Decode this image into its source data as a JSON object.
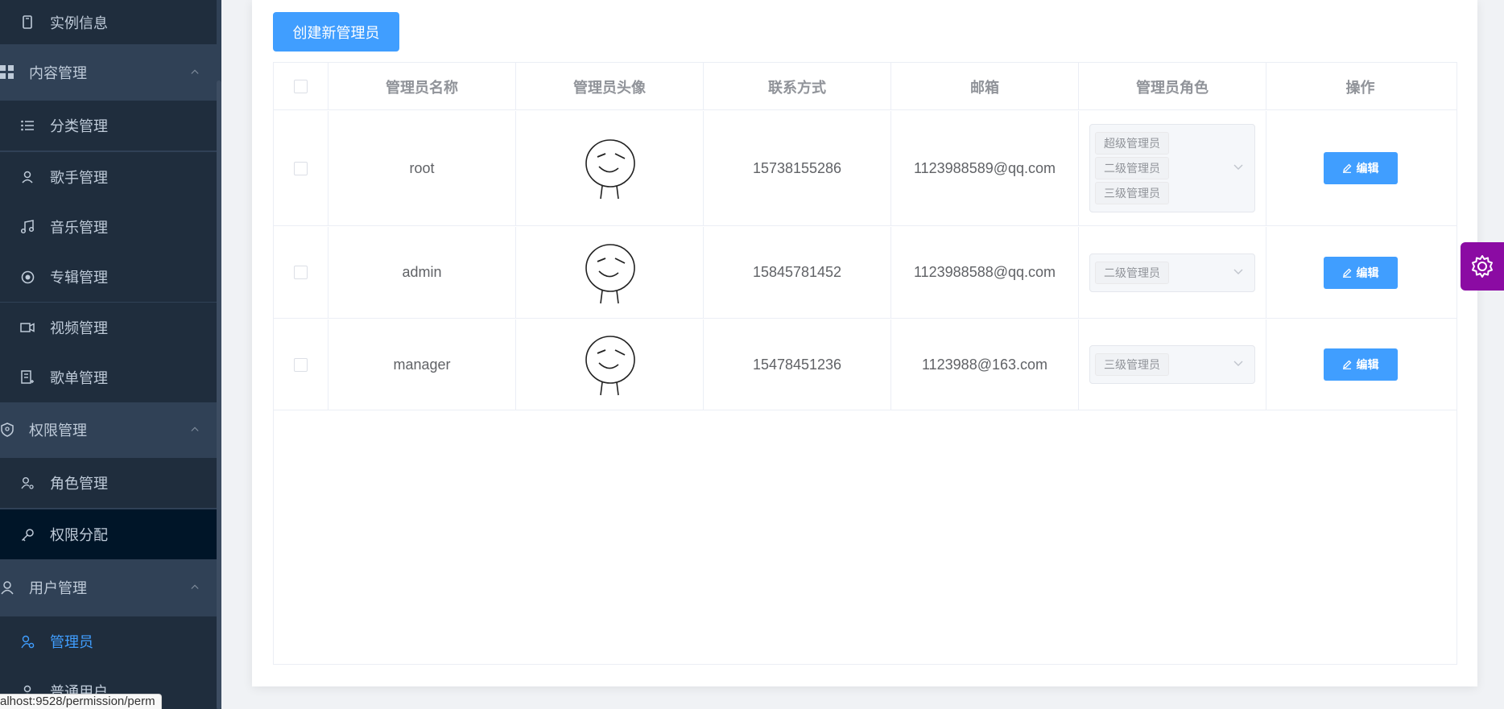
{
  "sidebar": {
    "items": [
      {
        "label": "实例信息",
        "icon": "phone-icon"
      },
      {
        "label": "内容管理",
        "icon": "grid-icon"
      },
      {
        "label": "分类管理",
        "icon": "list-icon"
      },
      {
        "label": "歌手管理",
        "icon": "user-icon"
      },
      {
        "label": "音乐管理",
        "icon": "music-icon"
      },
      {
        "label": "专辑管理",
        "icon": "disc-icon"
      },
      {
        "label": "视频管理",
        "icon": "video-icon"
      },
      {
        "label": "歌单管理",
        "icon": "playlist-icon"
      },
      {
        "label": "权限管理",
        "icon": "shield-icon"
      },
      {
        "label": "角色管理",
        "icon": "user-gear-icon"
      },
      {
        "label": "权限分配",
        "icon": "key-icon"
      },
      {
        "label": "用户管理",
        "icon": "user-icon"
      },
      {
        "label": "管理员",
        "icon": "admin-icon"
      },
      {
        "label": "普通用户",
        "icon": "user-icon"
      }
    ]
  },
  "status_url": "alhost:9528/permission/perm",
  "toolbar": {
    "create_label": "创建新管理员"
  },
  "table": {
    "headers": [
      "管理员名称",
      "管理员头像",
      "联系方式",
      "邮箱",
      "管理员角色",
      "操作"
    ],
    "rows": [
      {
        "name": "root",
        "phone": "15738155286",
        "email": "1123988589@qq.com",
        "roles": [
          "超级管理员",
          "二级管理员",
          "三级管理员"
        ],
        "action": "编辑"
      },
      {
        "name": "admin",
        "phone": "15845781452",
        "email": "1123988588@qq.com",
        "roles": [
          "二级管理员"
        ],
        "action": "编辑"
      },
      {
        "name": "manager",
        "phone": "15478451236",
        "email": "1123988@163.com",
        "roles": [
          "三级管理员"
        ],
        "action": "编辑"
      }
    ]
  },
  "colors": {
    "sidebar_bg": "#304156",
    "submenu_bg": "#1f2d3d",
    "primary": "#409eff",
    "settings_bg": "#8b0ba3"
  }
}
